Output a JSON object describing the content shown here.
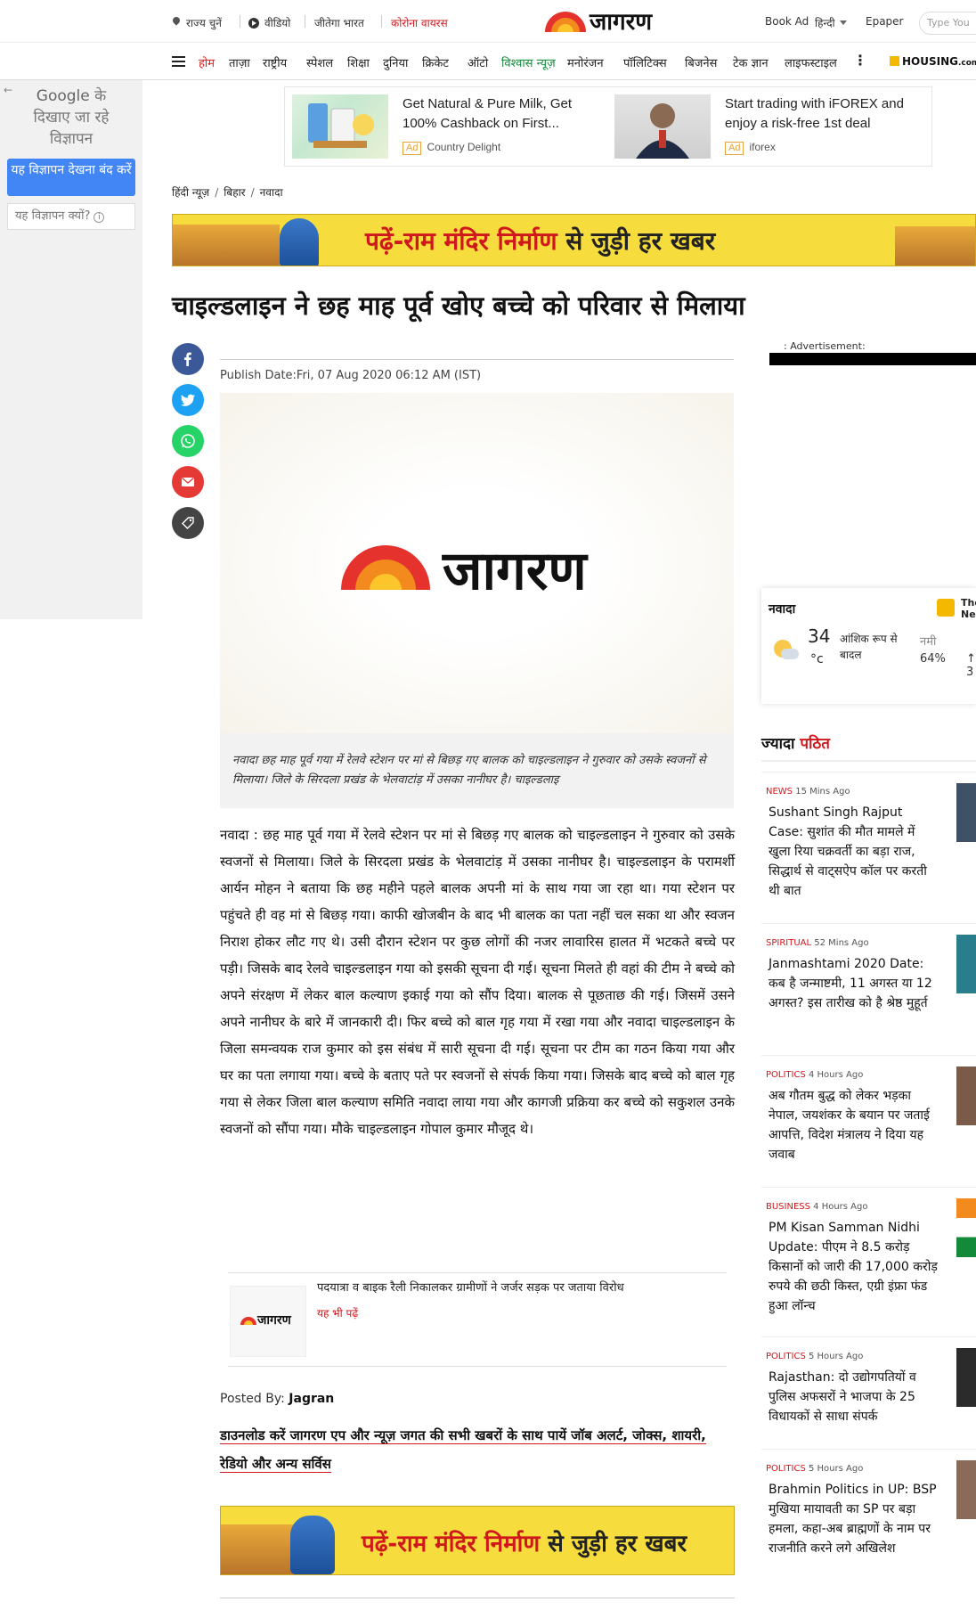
{
  "topbar": {
    "state": "राज्य चुनें",
    "video": "वीडियो",
    "jeetega": "जीतेगा भारत",
    "corona": "कोरोना वायरस",
    "book_ad": "Book Ad",
    "language": "हिन्दी",
    "epaper": "Epaper",
    "search_placeholder": "Type You",
    "logo": "जागरण"
  },
  "nav": {
    "items": [
      "होम",
      "ताज़ा",
      "राष्ट्रीय",
      "स्पेशल",
      "शिक्षा",
      "दुनिया",
      "क्रिकेट",
      "ऑटो",
      "विश्वास न्यूज़",
      "मनोरंजन",
      "पॉलिटिक्स",
      "बिजनेस",
      "टेक ज्ञान",
      "लाइफस्टाइल"
    ],
    "more": "⋮",
    "housing": "HOUSING",
    "housing_suffix": ".com"
  },
  "google_panel": {
    "line1_a": "Google",
    "line1_b": " के",
    "line2": "दिखाए जा रहे",
    "line3": "विज्ञापन",
    "stop_button": "यह विज्ञापन देखना बंद करें",
    "why_button": "यह विज्ञापन क्यों?",
    "info": "i"
  },
  "ads": [
    {
      "title": "Get Natural & Pure Milk, Get 100% Cashback on First...",
      "badge": "Ad",
      "advertiser": "Country Delight"
    },
    {
      "title": "Start trading with iFOREX and enjoy a risk-free 1st deal",
      "badge": "Ad",
      "advertiser": "iforex"
    }
  ],
  "breadcrumb": [
    "हिंदी न्यूज़",
    "बिहार",
    "नवादा"
  ],
  "banner": {
    "part1": "पढ़ें-",
    "part2": "राम मंदिर निर्माण",
    "part3": " से जुड़ी हर खबर"
  },
  "article": {
    "headline": "चाइल्डलाइन ने छह माह पूर्व खोए बच्चे को परिवार से मिलाया",
    "publish_date": "Publish Date:Fri, 07 Aug 2020 06:12 AM (IST)",
    "image_logo": "जागरण",
    "caption": "नवादा छह माह पूर्व गया में रेलवे स्टेशन पर मां से बिछड़ गए बालक को चाइल्डलाइन ने गुरुवार को उसके स्वजनों से मिलाया। जिले के सिरदला प्रखंड के भेलवाटांड़ में उसका नानीघर है। चाइल्डलाइ",
    "body": "नवादा : छह माह पूर्व गया में रेलवे स्टेशन पर मां से बिछड़ गए बालक को चाइल्डलाइन ने गुरुवार को उसके स्वजनों से मिलाया। जिले के सिरदला प्रखंड के भेलवाटांड़ में उसका नानीघर है। चाइल्डलाइन के परामर्शी आर्यन मोहन ने बताया कि छह महीने पहले बालक अपनी मां के साथ गया जा रहा था। गया स्टेशन पर पहुंचते ही वह मां से बिछड़ गया। काफी खोजबीन के बाद भी बालक का पता नहीं चल सका था और स्वजन निराश होकर लौट गए थे। उसी दौरान स्टेशन पर कुछ लोगों की नजर लावारिस हालत में भटकते बच्चे पर पड़ी। जिसके बाद रेलवे चाइल्डलाइन गया को इसकी सूचना दी गई। सूचना मिलते ही वहां की टीम ने बच्चे को अपने संरक्षण में लेकर बाल कल्याण इकाई गया को सौंप दिया। बालक से पूछताछ की गई। जिसमें उसने अपने नानीघर के बारे में जानकारी दी। फिर बच्चे को बाल गृह गया में रखा गया और नवादा चाइल्डलाइन के जिला समन्वयक राज कुमार को इस संबंध में सारी सूचना दी गई। सूचना पर टीम का गठन किया गया और घर का पता लगाया गया। बच्चे के बताए पते पर स्वजनों से संपर्क किया गया। जिसके बाद बच्चे को बाल गृह गया से लेकर जिला बाल कल्याण समिति नवादा लाया गया और कागजी प्रक्रिया कर बच्चे को सकुशल उनके स्वजनों को सौंपा गया। मौके चाइल्डलाइन गोपाल कुमार मौजूद थे।",
    "also_read_title": "पदयात्रा व बाइक रैली निकालकर ग्रामीणों ने जर्जर सड़क पर जताया विरोध",
    "also_read_label": "यह भी पढ़ें",
    "also_thumb_logo": "जागरण",
    "posted_label": "Posted By: ",
    "posted_by": "Jagran",
    "download": "डाउनलोड करें जागरण एप और न्यूज़ जगत की सभी खबरों के साथ पायें जॉब अलर्ट, जोक्स, शायरी, रेडियो और अन्य सर्विस"
  },
  "sidebar": {
    "advertisement": ": Advertisement:",
    "weather": {
      "city": "नवादा",
      "temp": "34",
      "unit": "°c",
      "condition": "आंशिक रूप से बादल",
      "humidity_label": "नमी",
      "humidity": "64%",
      "more": "↑ 3",
      "partner": "The Ne"
    },
    "most_read_a": "ज्यादा ",
    "most_read_b": "पठित",
    "trending": [
      {
        "cat": "NEWS",
        "time": " 15 Mins Ago",
        "title": "Sushant Singh Rajput Case: सुशांत की मौत मामले में खुला रिया चक्रवर्ती का बड़ा राज, सिद्धार्थ से वाट्सऐप कॉल पर करती थी बात"
      },
      {
        "cat": "SPIRITUAL",
        "time": " 52 Mins Ago",
        "title": "Janmashtami 2020 Date: कब है जन्माष्टमी, 11 अगस्त या 12 अगस्त? इस तारीख को है श्रेष्ठ मुहूर्त"
      },
      {
        "cat": "POLITICS",
        "time": " 4 Hours Ago",
        "title": "अब गौतम बुद्ध को लेकर भड़का नेपाल, जयशंकर के बयान पर जताई आपत्ति, विदेश मंत्रालय ने दिया यह जवाब"
      },
      {
        "cat": "BUSINESS",
        "time": " 4 Hours Ago",
        "title": "PM Kisan Samman Nidhi Update: पीएम ने 8.5 करोड़ किसानों को जारी की 17,000 करोड़ रुपये की छठी किस्त, एग्री इंफ्रा फंड हुआ लॉन्च"
      },
      {
        "cat": "POLITICS",
        "time": " 5 Hours Ago",
        "title": "Rajasthan: दो उद्योगपतियों व पुलिस अफसरों ने भाजपा के 25 विधायकों से साधा संपर्क"
      },
      {
        "cat": "POLITICS",
        "time": " 5 Hours Ago",
        "title": "Brahmin Politics in UP: BSP मुखिया मायावती का SP पर बड़ा हमला, कहा-अब ब्राह्मणों के नाम पर राजनीति करने लगे अखिलेश"
      }
    ]
  },
  "colors": {
    "brand_red": "#d0171b",
    "facebook": "#3b5998",
    "twitter": "#1da1f2",
    "whatsapp": "#25d366",
    "email": "#e53935",
    "tag": "#444444",
    "banner_yellow": "#f6dc3c"
  }
}
